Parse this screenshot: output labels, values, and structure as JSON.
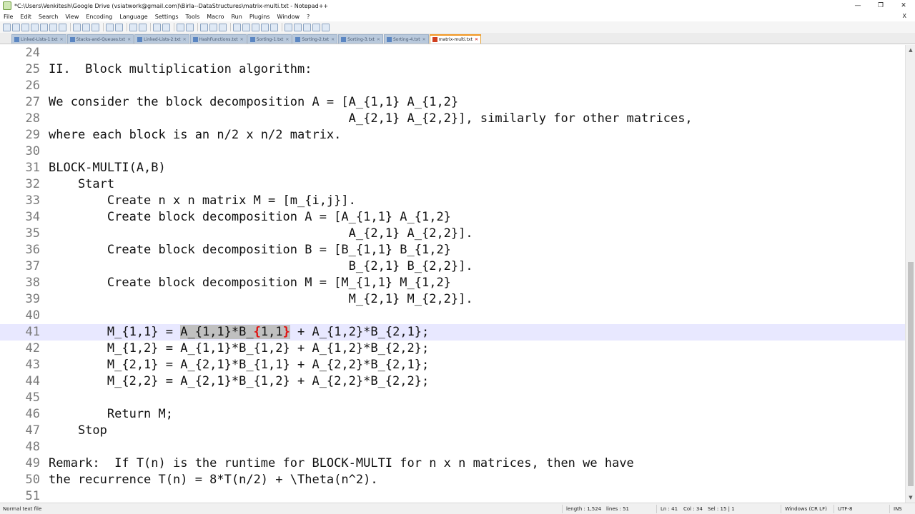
{
  "window": {
    "title": "*C:\\Users\\Venkitesh\\Google Drive (vsiatwork@gmail.com)\\Birla--DataStructures\\matrix-multi.txt - Notepad++",
    "minimize": "—",
    "maximize": "❐",
    "close": "✕"
  },
  "menu": {
    "items": [
      "File",
      "Edit",
      "Search",
      "View",
      "Encoding",
      "Language",
      "Settings",
      "Tools",
      "Macro",
      "Run",
      "Plugins",
      "Window",
      "?"
    ],
    "close_doc": "X"
  },
  "tabs": [
    {
      "label": "Linked-Lists-1.txt",
      "active": false
    },
    {
      "label": "Stacks-and-Queues.txt",
      "active": false
    },
    {
      "label": "Linked-Lists-2.txt",
      "active": false
    },
    {
      "label": "HashFunctions.txt",
      "active": false
    },
    {
      "label": "Sorting-1.txt",
      "active": false
    },
    {
      "label": "Sorting-2.txt",
      "active": false
    },
    {
      "label": "Sorting-3.txt",
      "active": false
    },
    {
      "label": "Sorting-4.txt",
      "active": false
    },
    {
      "label": "matrix-multi.txt",
      "active": true
    }
  ],
  "editor": {
    "lines": [
      {
        "n": "24",
        "text": ""
      },
      {
        "n": "25",
        "text": "II.  Block multiplication algorithm:"
      },
      {
        "n": "26",
        "text": ""
      },
      {
        "n": "27",
        "text": "We consider the block decomposition A = [A_{1,1} A_{1,2}"
      },
      {
        "n": "28",
        "text": "                                         A_{2,1} A_{2,2}], similarly for other matrices,"
      },
      {
        "n": "29",
        "text": "where each block is an n/2 x n/2 matrix."
      },
      {
        "n": "30",
        "text": ""
      },
      {
        "n": "31",
        "text": "BLOCK-MULTI(A,B)"
      },
      {
        "n": "32",
        "text": "    Start"
      },
      {
        "n": "33",
        "text": "        Create n x n matrix M = [m_{i,j}]."
      },
      {
        "n": "34",
        "text": "        Create block decomposition A = [A_{1,1} A_{1,2}"
      },
      {
        "n": "35",
        "text": "                                         A_{2,1} A_{2,2}]."
      },
      {
        "n": "36",
        "text": "        Create block decomposition B = [B_{1,1} B_{1,2}"
      },
      {
        "n": "37",
        "text": "                                         B_{2,1} B_{2,2}]."
      },
      {
        "n": "38",
        "text": "        Create block decomposition M = [M_{1,1} M_{1,2}"
      },
      {
        "n": "39",
        "text": "                                         M_{2,1} M_{2,2}]."
      },
      {
        "n": "40",
        "text": ""
      },
      {
        "n": "41",
        "pre": "        M_{1,1} = ",
        "sel": "A_{1,1}*B_",
        "brace_open": "{",
        "sel_mid": "1,1",
        "brace_close": "}",
        "post": " + A_{1,2}*B_{2,1};",
        "current": true
      },
      {
        "n": "42",
        "text": "        M_{1,2} = A_{1,1}*B_{1,2} + A_{1,2}*B_{2,2};"
      },
      {
        "n": "43",
        "text": "        M_{2,1} = A_{2,1}*B_{1,1} + A_{2,2}*B_{2,1};"
      },
      {
        "n": "44",
        "text": "        M_{2,2} = A_{2,1}*B_{1,2} + A_{2,2}*B_{2,2};"
      },
      {
        "n": "45",
        "text": ""
      },
      {
        "n": "46",
        "text": "        Return M;"
      },
      {
        "n": "47",
        "text": "    Stop"
      },
      {
        "n": "48",
        "text": ""
      },
      {
        "n": "49",
        "text": "Remark:  If T(n) is the runtime for BLOCK-MULTI for n x n matrices, then we have"
      },
      {
        "n": "50",
        "text": "the recurrence T(n) = 8*T(n/2) + \\Theta(n^2)."
      },
      {
        "n": "51",
        "text": ""
      }
    ]
  },
  "status": {
    "file_type": "Normal text file",
    "length": "length : 1,524",
    "lines": "lines : 51",
    "ln": "Ln : 41",
    "col": "Col : 34",
    "sel": "Sel : 15 | 1",
    "eol": "Windows (CR LF)",
    "encoding": "UTF-8",
    "mode": "INS"
  }
}
